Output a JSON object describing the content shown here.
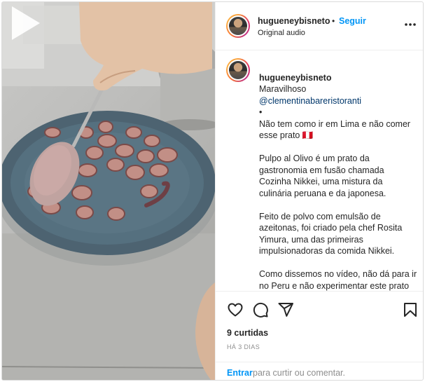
{
  "post": {
    "username": "hugueneybisneto",
    "separator": "•",
    "follow_label": "Seguir",
    "audio_label": "Original audio"
  },
  "caption": {
    "username": "hugueneybisneto",
    "first_word": "Maravilhoso",
    "mention": "@clementinabareristoranti",
    "paragraphs": [
      "•\nNão tem como ir em Lima e não comer esse prato 🇵🇪",
      "Pulpo al Olivo é um prato da gastronomia em fusão chamada Cozinha Nikkei, uma mistura da culinária peruana e da japonesa.",
      "Feito de polvo com emulsão de azeitonas, foi criado pela chef Rosita Yimura, uma das primeiras impulsionadoras da comida Nikkei.",
      "Como dissemos no vídeo, não dá para ir no Peru e não experimentar este prato no restaurante da chef, em Lima."
    ]
  },
  "engagement": {
    "likes": "9 curtidas",
    "timestamp": "HÁ 3 DIAS"
  },
  "comment": {
    "enter_label": "Entrar",
    "rest_label": "para curtir ou comentar."
  },
  "icons": {
    "play": "play-icon",
    "more": "more-options-icon",
    "like": "heart-icon",
    "comment": "comment-icon",
    "share": "share-icon",
    "save": "bookmark-icon"
  }
}
